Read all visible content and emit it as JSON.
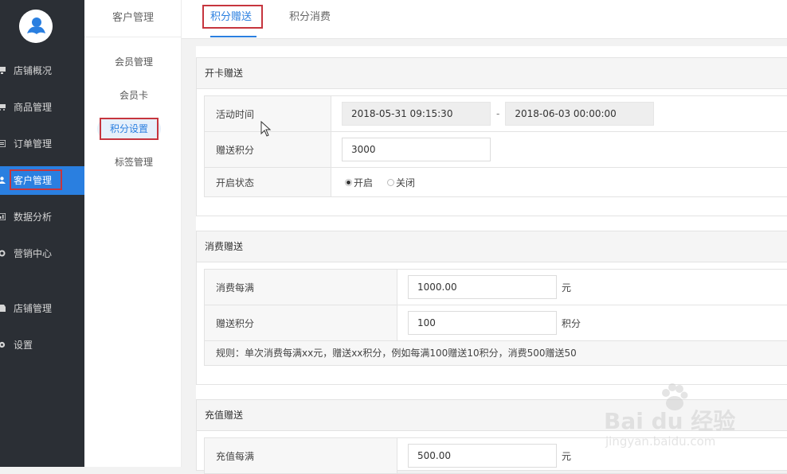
{
  "sidebar": {
    "items": [
      {
        "label": "店铺概况"
      },
      {
        "label": "商品管理"
      },
      {
        "label": "订单管理"
      },
      {
        "label": "客户管理"
      },
      {
        "label": "数据分析"
      },
      {
        "label": "营销中心"
      },
      {
        "label": "店铺管理"
      },
      {
        "label": "设置"
      }
    ],
    "accent_color": "#2a7fe0"
  },
  "subnav": {
    "title": "客户管理",
    "items": [
      {
        "label": "会员管理"
      },
      {
        "label": "会员卡"
      },
      {
        "label": "积分设置"
      },
      {
        "label": "标签管理"
      }
    ]
  },
  "tabs": [
    {
      "label": "积分赠送"
    },
    {
      "label": "积分消费"
    }
  ],
  "open_card": {
    "title": "开卡赠送",
    "activity_time_label": "活动时间",
    "start_time": "2018-05-31 09:15:30",
    "range_separator": "-",
    "end_time": "2018-06-03 00:00:00",
    "points_label": "赠送积分",
    "points_value": "3000",
    "status_label": "开启状态",
    "status_on": "开启",
    "status_off": "关闭"
  },
  "consume": {
    "title": "消费赠送",
    "every_label": "消费每满",
    "every_value": "1000.00",
    "every_unit": "元",
    "points_label": "赠送积分",
    "points_value": "100",
    "points_unit": "积分",
    "rule": "规则：单次消费每满xx元，赠送xx积分，例如每满100赠送10积分，消费500赠送50"
  },
  "recharge": {
    "title": "充值赠送",
    "every_label": "充值每满",
    "every_value": "500.00",
    "every_unit": "元"
  },
  "watermark": {
    "brand": "Bai du 经验",
    "url": "jingyan.baidu.com"
  }
}
